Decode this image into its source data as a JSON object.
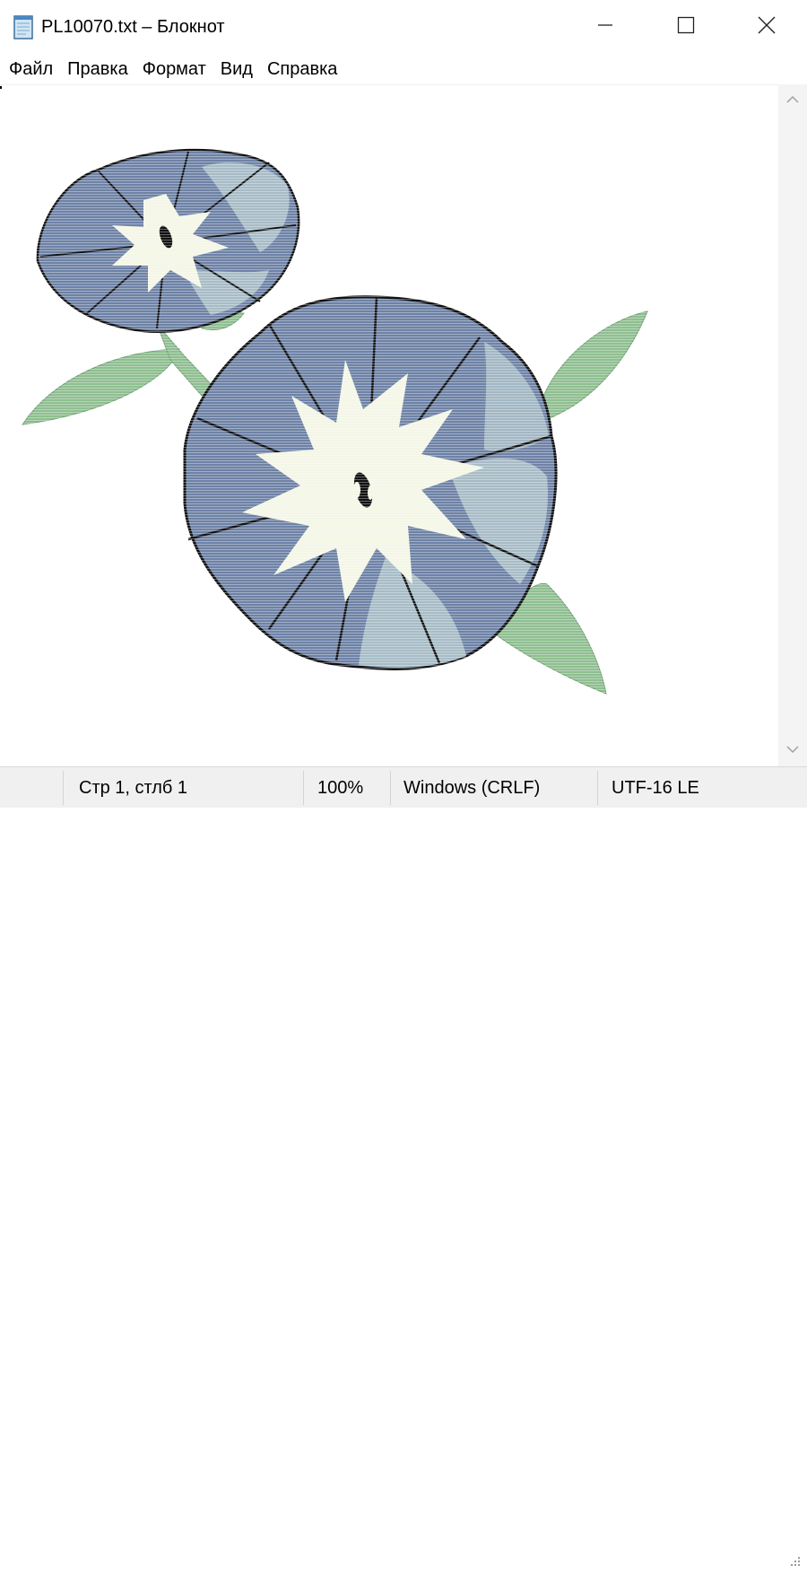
{
  "window": {
    "title": "PL10070.txt – Блокнот",
    "icon": "notepad-icon"
  },
  "controls": {
    "minimize_icon": "minimize-icon",
    "maximize_icon": "maximize-icon",
    "close_icon": "close-icon"
  },
  "menu": {
    "items": [
      {
        "label": "Файл"
      },
      {
        "label": "Правка"
      },
      {
        "label": "Формат"
      },
      {
        "label": "Вид"
      },
      {
        "label": "Справка"
      }
    ]
  },
  "editor": {
    "content": "morning-glory-flowers-illustration",
    "colors": {
      "petal_dark": "#6e82a6",
      "petal_light": "#a7bcc6",
      "center": "#f4f6e6",
      "leaf": "#8fbf91",
      "outline": "#111111"
    }
  },
  "status": {
    "position": "Стр 1, стлб 1",
    "zoom": "100%",
    "line_ending": "Windows (CRLF)",
    "encoding": "UTF-16 LE"
  }
}
